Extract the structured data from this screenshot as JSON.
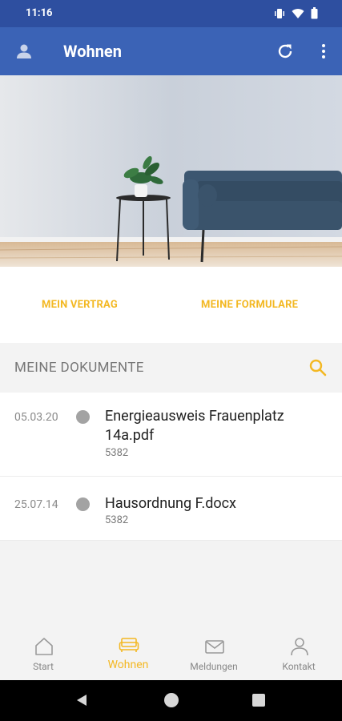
{
  "status_bar": {
    "time": "11:16"
  },
  "app_bar": {
    "title": "Wohnen"
  },
  "quick_links": {
    "vertrag": "MEIN VERTRAG",
    "formulare": "MEINE FORMULARE"
  },
  "documents": {
    "header": "MEINE DOKUMENTE",
    "items": [
      {
        "date": "05.03.20",
        "name": "Energieausweis Frauenplatz 14a.pdf",
        "sub": "5382"
      },
      {
        "date": "25.07.14",
        "name": "Hausordnung F.docx",
        "sub": "5382"
      }
    ]
  },
  "bottom_nav": {
    "start": "Start",
    "wohnen": "Wohnen",
    "meldungen": "Meldungen",
    "kontakt": "Kontakt",
    "active": "wohnen"
  },
  "colors": {
    "primary": "#3b63b6",
    "status": "#2e4fa0",
    "accent": "#f3b823"
  }
}
